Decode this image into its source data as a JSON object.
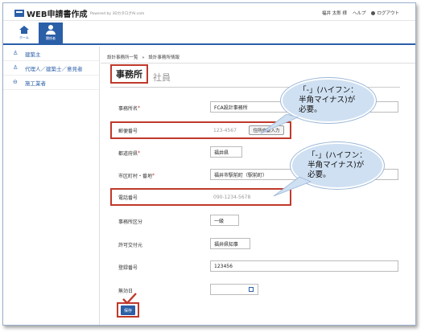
{
  "header": {
    "app_title": "WEB申請書作成",
    "powered": "Powered by 3DカタログAI.com",
    "user": "福井 太郎 様",
    "help": "ヘルプ",
    "logout": "ログアウト"
  },
  "tiles": {
    "home_label": "ホーム",
    "user_label": "関係者"
  },
  "sidebar": {
    "items": [
      {
        "label": "建築主",
        "icon": "person-icon"
      },
      {
        "label": "代理人／建築士／意見者",
        "icon": "people-icon"
      },
      {
        "label": "施工業者",
        "icon": "company-icon"
      }
    ]
  },
  "breadcrumb": {
    "parent": "設計事務所一覧",
    "sep": "»",
    "current": "設計事務所情報"
  },
  "tabs": {
    "active": "事務所",
    "inactive": "社員"
  },
  "form": {
    "office_name_label": "事務所名",
    "office_name_value": "FCA設計事務所",
    "postal_label": "郵便番号",
    "postal_placeholder": "123-4567",
    "address_button": "住所自動入力",
    "prefecture_label": "都道府県",
    "prefecture_value": "福井県",
    "city_label": "市区町村・番地",
    "city_value": "福井市駅前町（駅前町）",
    "phone_label": "電話番号",
    "phone_placeholder": "090-1234-5678",
    "grade_label": "事務所区分",
    "grade_value": "一級",
    "permit_label": "許可交付元",
    "permit_value": "福井県知事",
    "reg_label": "登録番号",
    "reg_value": "123456",
    "expiry_label": "無効日",
    "save_button": "保存",
    "required_mark": "*"
  },
  "callouts": {
    "line1": "「-」(ハイフン：",
    "line2": "半角マイナス)が",
    "line3": "必要。"
  },
  "colors": {
    "brand": "#2b5fa8",
    "highlight": "#c0392b",
    "callout_fill": "#cfe0f2"
  }
}
